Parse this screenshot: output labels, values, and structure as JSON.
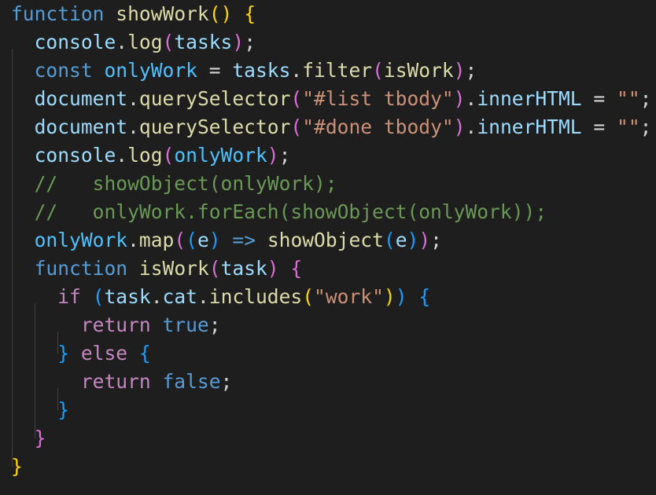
{
  "theme": {
    "background": "#1e1e1e",
    "guide": "#404040"
  },
  "code_lines": [
    [
      {
        "t": "function",
        "c": "#569cd6"
      },
      {
        "t": " ",
        "c": "#d4d4d4"
      },
      {
        "t": "showWork",
        "c": "#dcdcaa"
      },
      {
        "t": "()",
        "c": "#ffd700"
      },
      {
        "t": " ",
        "c": "#d4d4d4"
      },
      {
        "t": "{",
        "c": "#ffd700"
      }
    ],
    [
      {
        "t": "  ",
        "c": "#d4d4d4"
      },
      {
        "t": "console",
        "c": "#9cdcfe"
      },
      {
        "t": ".",
        "c": "#d4d4d4"
      },
      {
        "t": "log",
        "c": "#dcdcaa"
      },
      {
        "t": "(",
        "c": "#da70d6"
      },
      {
        "t": "tasks",
        "c": "#9cdcfe"
      },
      {
        "t": ")",
        "c": "#da70d6"
      },
      {
        "t": ";",
        "c": "#d4d4d4"
      }
    ],
    [
      {
        "t": "  ",
        "c": "#d4d4d4"
      },
      {
        "t": "const",
        "c": "#569cd6"
      },
      {
        "t": " ",
        "c": "#d4d4d4"
      },
      {
        "t": "onlyWork",
        "c": "#4fc1ff"
      },
      {
        "t": " = ",
        "c": "#d4d4d4"
      },
      {
        "t": "tasks",
        "c": "#9cdcfe"
      },
      {
        "t": ".",
        "c": "#d4d4d4"
      },
      {
        "t": "filter",
        "c": "#dcdcaa"
      },
      {
        "t": "(",
        "c": "#da70d6"
      },
      {
        "t": "isWork",
        "c": "#dcdcaa"
      },
      {
        "t": ")",
        "c": "#da70d6"
      },
      {
        "t": ";",
        "c": "#d4d4d4"
      }
    ],
    [
      {
        "t": "  ",
        "c": "#d4d4d4"
      },
      {
        "t": "document",
        "c": "#9cdcfe"
      },
      {
        "t": ".",
        "c": "#d4d4d4"
      },
      {
        "t": "querySelector",
        "c": "#dcdcaa"
      },
      {
        "t": "(",
        "c": "#da70d6"
      },
      {
        "t": "\"#list tbody\"",
        "c": "#ce9178"
      },
      {
        "t": ")",
        "c": "#da70d6"
      },
      {
        "t": ".",
        "c": "#d4d4d4"
      },
      {
        "t": "innerHTML",
        "c": "#9cdcfe"
      },
      {
        "t": " = ",
        "c": "#d4d4d4"
      },
      {
        "t": "\"\"",
        "c": "#ce9178"
      },
      {
        "t": ";",
        "c": "#d4d4d4"
      }
    ],
    [
      {
        "t": "  ",
        "c": "#d4d4d4"
      },
      {
        "t": "document",
        "c": "#9cdcfe"
      },
      {
        "t": ".",
        "c": "#d4d4d4"
      },
      {
        "t": "querySelector",
        "c": "#dcdcaa"
      },
      {
        "t": "(",
        "c": "#da70d6"
      },
      {
        "t": "\"#done tbody\"",
        "c": "#ce9178"
      },
      {
        "t": ")",
        "c": "#da70d6"
      },
      {
        "t": ".",
        "c": "#d4d4d4"
      },
      {
        "t": "innerHTML",
        "c": "#9cdcfe"
      },
      {
        "t": " = ",
        "c": "#d4d4d4"
      },
      {
        "t": "\"\"",
        "c": "#ce9178"
      },
      {
        "t": ";",
        "c": "#d4d4d4"
      }
    ],
    [
      {
        "t": "  ",
        "c": "#d4d4d4"
      },
      {
        "t": "console",
        "c": "#9cdcfe"
      },
      {
        "t": ".",
        "c": "#d4d4d4"
      },
      {
        "t": "log",
        "c": "#dcdcaa"
      },
      {
        "t": "(",
        "c": "#da70d6"
      },
      {
        "t": "onlyWork",
        "c": "#4fc1ff"
      },
      {
        "t": ")",
        "c": "#da70d6"
      },
      {
        "t": ";",
        "c": "#d4d4d4"
      }
    ],
    [
      {
        "t": "  ",
        "c": "#d4d4d4"
      },
      {
        "t": "//   showObject(onlyWork);",
        "c": "#6a9955"
      }
    ],
    [
      {
        "t": "  ",
        "c": "#d4d4d4"
      },
      {
        "t": "//   onlyWork.forEach(showObject(onlyWork));",
        "c": "#6a9955"
      }
    ],
    [
      {
        "t": "  ",
        "c": "#d4d4d4"
      },
      {
        "t": "onlyWork",
        "c": "#4fc1ff"
      },
      {
        "t": ".",
        "c": "#d4d4d4"
      },
      {
        "t": "map",
        "c": "#dcdcaa"
      },
      {
        "t": "(",
        "c": "#da70d6"
      },
      {
        "t": "(",
        "c": "#179fff"
      },
      {
        "t": "e",
        "c": "#9cdcfe"
      },
      {
        "t": ")",
        "c": "#179fff"
      },
      {
        "t": " ",
        "c": "#d4d4d4"
      },
      {
        "t": "=>",
        "c": "#569cd6"
      },
      {
        "t": " ",
        "c": "#d4d4d4"
      },
      {
        "t": "showObject",
        "c": "#dcdcaa"
      },
      {
        "t": "(",
        "c": "#179fff"
      },
      {
        "t": "e",
        "c": "#9cdcfe"
      },
      {
        "t": ")",
        "c": "#179fff"
      },
      {
        "t": ")",
        "c": "#da70d6"
      },
      {
        "t": ";",
        "c": "#d4d4d4"
      }
    ],
    [
      {
        "t": "  ",
        "c": "#d4d4d4"
      },
      {
        "t": "function",
        "c": "#569cd6"
      },
      {
        "t": " ",
        "c": "#d4d4d4"
      },
      {
        "t": "isWork",
        "c": "#dcdcaa"
      },
      {
        "t": "(",
        "c": "#da70d6"
      },
      {
        "t": "task",
        "c": "#9cdcfe"
      },
      {
        "t": ")",
        "c": "#da70d6"
      },
      {
        "t": " ",
        "c": "#d4d4d4"
      },
      {
        "t": "{",
        "c": "#da70d6"
      }
    ],
    [
      {
        "t": "    ",
        "c": "#d4d4d4"
      },
      {
        "t": "if",
        "c": "#c586c0"
      },
      {
        "t": " ",
        "c": "#d4d4d4"
      },
      {
        "t": "(",
        "c": "#179fff"
      },
      {
        "t": "task",
        "c": "#9cdcfe"
      },
      {
        "t": ".",
        "c": "#d4d4d4"
      },
      {
        "t": "cat",
        "c": "#9cdcfe"
      },
      {
        "t": ".",
        "c": "#d4d4d4"
      },
      {
        "t": "includes",
        "c": "#dcdcaa"
      },
      {
        "t": "(",
        "c": "#ffd700"
      },
      {
        "t": "\"work\"",
        "c": "#ce9178"
      },
      {
        "t": ")",
        "c": "#ffd700"
      },
      {
        "t": ")",
        "c": "#179fff"
      },
      {
        "t": " ",
        "c": "#d4d4d4"
      },
      {
        "t": "{",
        "c": "#179fff"
      }
    ],
    [
      {
        "t": "      ",
        "c": "#d4d4d4"
      },
      {
        "t": "return",
        "c": "#c586c0"
      },
      {
        "t": " ",
        "c": "#d4d4d4"
      },
      {
        "t": "true",
        "c": "#569cd6"
      },
      {
        "t": ";",
        "c": "#d4d4d4"
      }
    ],
    [
      {
        "t": "    ",
        "c": "#d4d4d4"
      },
      {
        "t": "}",
        "c": "#179fff"
      },
      {
        "t": " ",
        "c": "#d4d4d4"
      },
      {
        "t": "else",
        "c": "#c586c0"
      },
      {
        "t": " ",
        "c": "#d4d4d4"
      },
      {
        "t": "{",
        "c": "#179fff"
      }
    ],
    [
      {
        "t": "      ",
        "c": "#d4d4d4"
      },
      {
        "t": "return",
        "c": "#c586c0"
      },
      {
        "t": " ",
        "c": "#d4d4d4"
      },
      {
        "t": "false",
        "c": "#569cd6"
      },
      {
        "t": ";",
        "c": "#d4d4d4"
      }
    ],
    [
      {
        "t": "    ",
        "c": "#d4d4d4"
      },
      {
        "t": "}",
        "c": "#179fff"
      }
    ],
    [
      {
        "t": "  ",
        "c": "#d4d4d4"
      },
      {
        "t": "}",
        "c": "#da70d6"
      }
    ],
    [
      {
        "t": "}",
        "c": "#ffd700"
      }
    ]
  ]
}
